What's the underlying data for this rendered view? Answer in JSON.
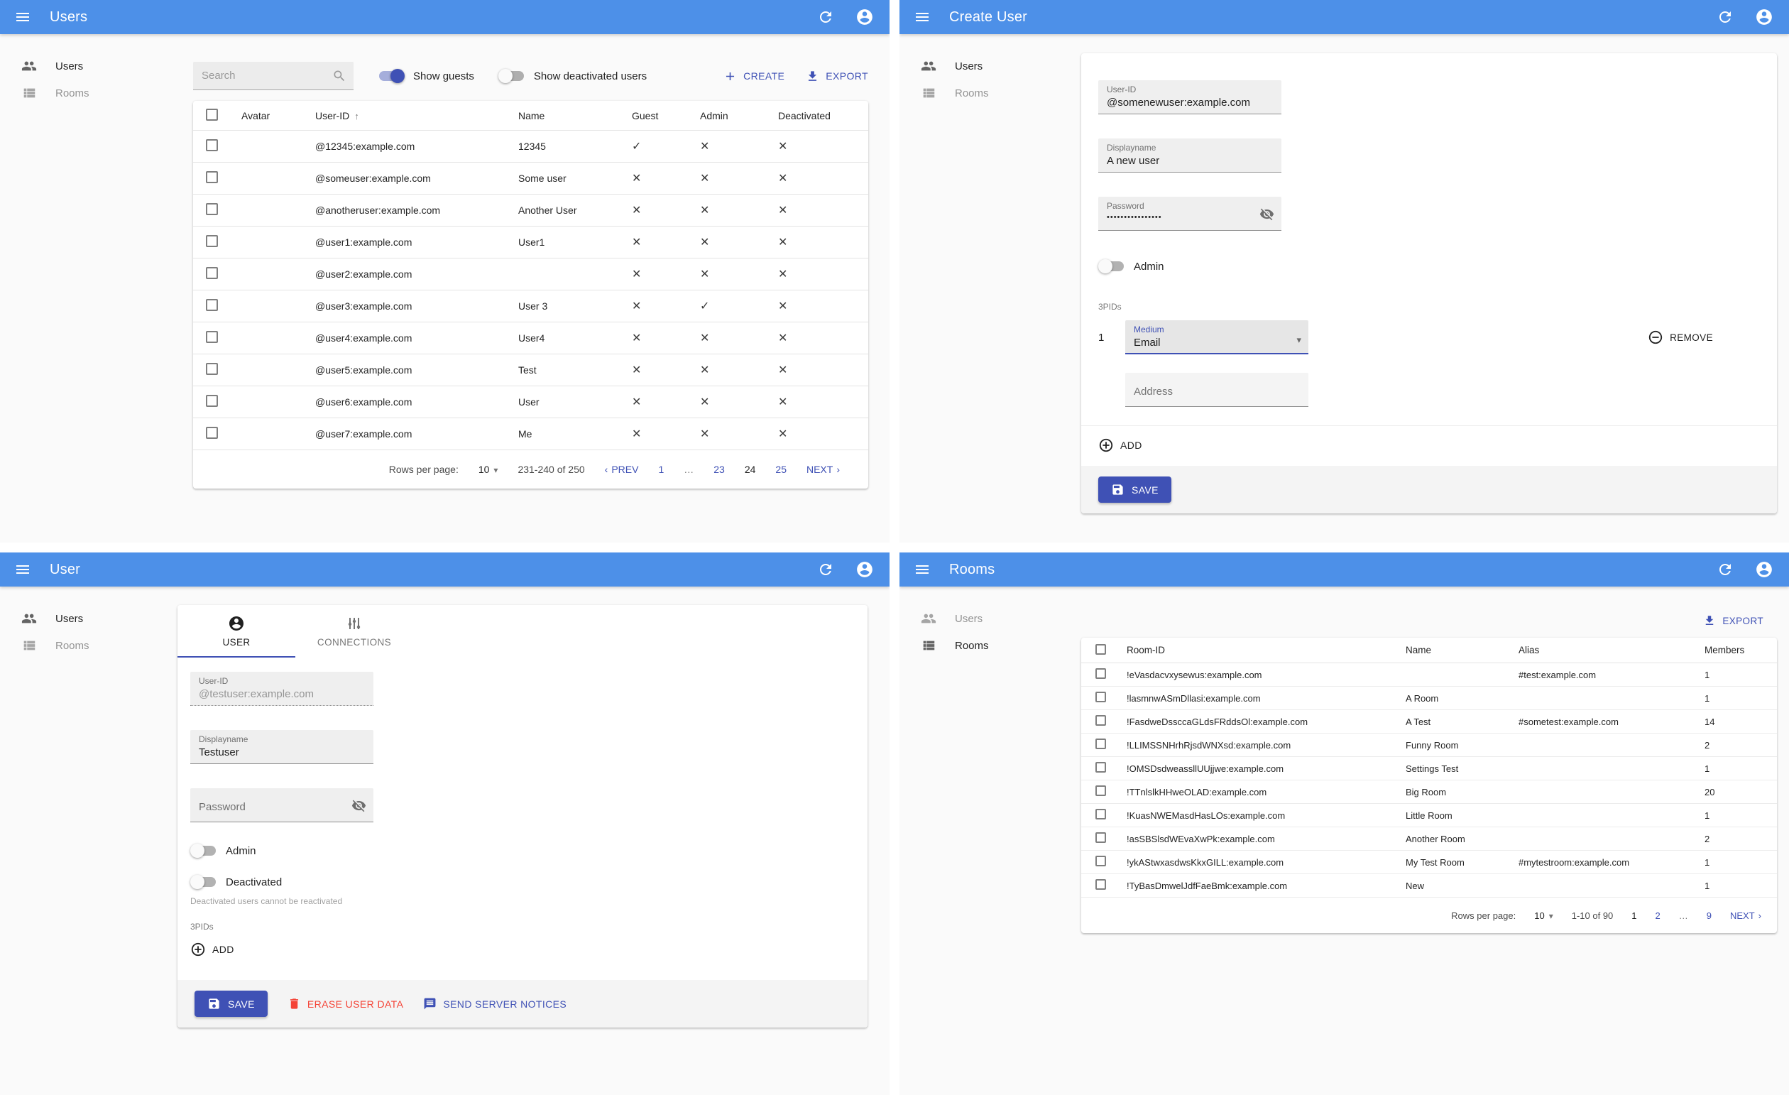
{
  "colors": {
    "appbar": "#4d90e8",
    "primary": "#3f51b5",
    "danger": "#f44336"
  },
  "icons": {
    "dropdown": "▾",
    "chevron_left": "‹",
    "chevron_right": "›",
    "sort_asc": "↑"
  },
  "nav": {
    "users": "Users",
    "rooms": "Rooms"
  },
  "users_list": {
    "title": "Users",
    "search_placeholder": "Search",
    "show_guests_label": "Show guests",
    "show_deactivated_label": "Show deactivated users",
    "create_label": "CREATE",
    "export_label": "EXPORT",
    "headers": {
      "avatar": "Avatar",
      "user_id": "User-ID",
      "name": "Name",
      "guest": "Guest",
      "admin": "Admin",
      "deactivated": "Deactivated"
    },
    "rows": [
      {
        "id": "@12345:example.com",
        "name": "12345",
        "guest": "✓",
        "admin": "✕",
        "deactivated": "✕"
      },
      {
        "id": "@someuser:example.com",
        "name": "Some user",
        "guest": "✕",
        "admin": "✕",
        "deactivated": "✕"
      },
      {
        "id": "@anotheruser:example.com",
        "name": "Another User",
        "guest": "✕",
        "admin": "✕",
        "deactivated": "✕"
      },
      {
        "id": "@user1:example.com",
        "name": "User1",
        "guest": "✕",
        "admin": "✕",
        "deactivated": "✕"
      },
      {
        "id": "@user2:example.com",
        "name": "",
        "guest": "✕",
        "admin": "✕",
        "deactivated": "✕"
      },
      {
        "id": "@user3:example.com",
        "name": "User 3",
        "guest": "✕",
        "admin": "✓",
        "deactivated": "✕"
      },
      {
        "id": "@user4:example.com",
        "name": "User4",
        "guest": "✕",
        "admin": "✕",
        "deactivated": "✕"
      },
      {
        "id": "@user5:example.com",
        "name": "Test",
        "guest": "✕",
        "admin": "✕",
        "deactivated": "✕"
      },
      {
        "id": "@user6:example.com",
        "name": "User",
        "guest": "✕",
        "admin": "✕",
        "deactivated": "✕"
      },
      {
        "id": "@user7:example.com",
        "name": "Me",
        "guest": "✕",
        "admin": "✕",
        "deactivated": "✕"
      }
    ],
    "pagination": {
      "rows_per_page_label": "Rows per page:",
      "rows_per_page": "10",
      "range": "231-240 of 250",
      "prev_label": "PREV",
      "pages": [
        "1",
        "…",
        "23",
        "24",
        "25"
      ],
      "next_label": "NEXT"
    }
  },
  "create_user": {
    "title": "Create User",
    "user_id": {
      "label": "User-ID",
      "value": "@somenewuser:example.com"
    },
    "displayname": {
      "label": "Displayname",
      "value": "A new user"
    },
    "password": {
      "label": "Password",
      "value": "••••••••••••••••"
    },
    "admin_label": "Admin",
    "threepids_label": "3PIDs",
    "row_index": "1",
    "medium": {
      "label": "Medium",
      "value": "Email"
    },
    "remove_label": "REMOVE",
    "address_placeholder": "Address",
    "add_label": "ADD",
    "save_label": "SAVE"
  },
  "user_detail": {
    "title": "User",
    "tabs": {
      "user": "USER",
      "connections": "CONNECTIONS"
    },
    "user_id": {
      "label": "User-ID",
      "value": "@testuser:example.com"
    },
    "displayname": {
      "label": "Displayname",
      "value": "Testuser"
    },
    "password_placeholder": "Password",
    "admin_label": "Admin",
    "deactivated_label": "Deactivated",
    "deactivated_helper": "Deactivated users cannot be reactivated",
    "threepids_label": "3PIDs",
    "add_label": "ADD",
    "save_label": "SAVE",
    "erase_label": "ERASE USER DATA",
    "notices_label": "SEND SERVER NOTICES"
  },
  "rooms_list": {
    "title": "Rooms",
    "export_label": "EXPORT",
    "headers": {
      "room_id": "Room-ID",
      "name": "Name",
      "alias": "Alias",
      "members": "Members"
    },
    "rows": [
      {
        "id": "!eVasdacvxysewus:example.com",
        "name": "",
        "alias": "#test:example.com",
        "members": "1"
      },
      {
        "id": "!lasmnwASmDllasi:example.com",
        "name": "A Room",
        "alias": "",
        "members": "1"
      },
      {
        "id": "!FasdweDssccaGLdsFRddsOl:example.com",
        "name": "A Test",
        "alias": "#sometest:example.com",
        "members": "14"
      },
      {
        "id": "!LLIMSSNHrhRjsdWNXsd:example.com",
        "name": "Funny Room",
        "alias": "",
        "members": "2"
      },
      {
        "id": "!OMSDsdweassllUUjjwe:example.com",
        "name": "Settings Test",
        "alias": "",
        "members": "1"
      },
      {
        "id": "!TTnlslkHHweOLAD:example.com",
        "name": "Big Room",
        "alias": "",
        "members": "20"
      },
      {
        "id": "!KuasNWEMasdHasLOs:example.com",
        "name": "Little Room",
        "alias": "",
        "members": "1"
      },
      {
        "id": "!asSBSlsdWEvaXwPk:example.com",
        "name": "Another Room",
        "alias": "",
        "members": "2"
      },
      {
        "id": "!ykAStwxasdwsKkxGILL:example.com",
        "name": "My Test Room",
        "alias": "#mytestroom:example.com",
        "members": "1"
      },
      {
        "id": "!TyBasDmwelJdfFaeBmk:example.com",
        "name": "New",
        "alias": "",
        "members": "1"
      }
    ],
    "pagination": {
      "rows_per_page_label": "Rows per page:",
      "rows_per_page": "10",
      "range": "1-10 of 90",
      "pages": [
        "1",
        "2",
        "…",
        "9"
      ],
      "next_label": "NEXT"
    }
  }
}
